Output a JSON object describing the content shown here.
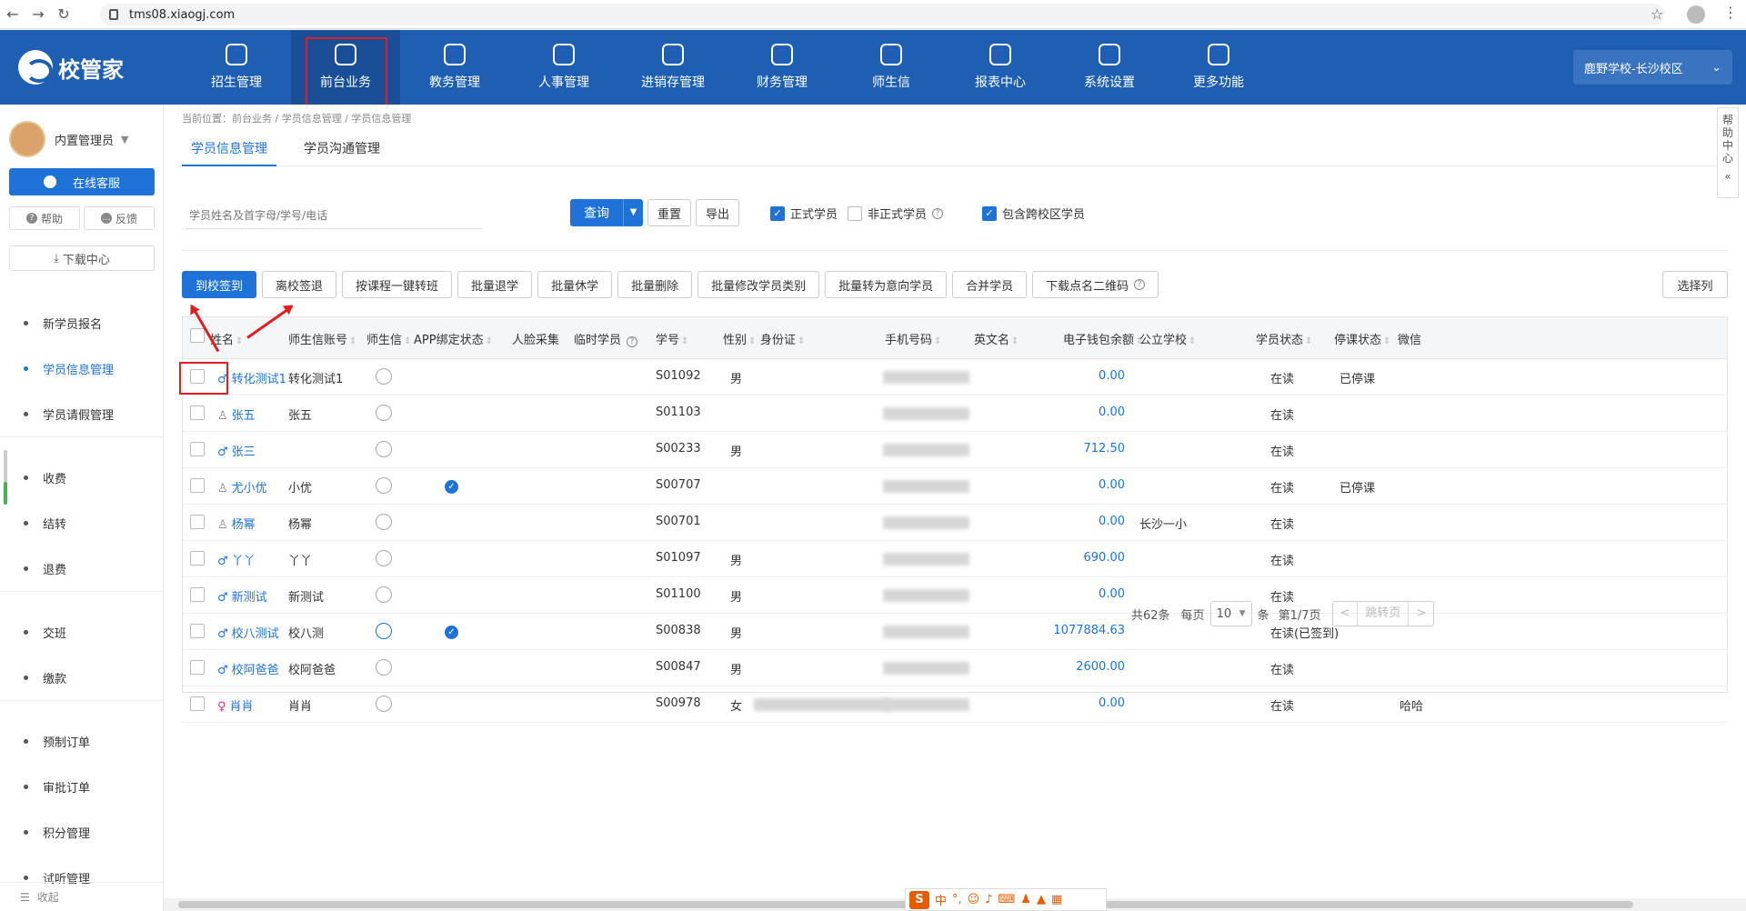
{
  "browser": {
    "url": "tms08.xiaogj.com"
  },
  "header": {
    "logo": "校管家",
    "nav": [
      {
        "label": "招生管理",
        "icon": "user-add-icon"
      },
      {
        "label": "前台业务",
        "icon": "front-desk-icon"
      },
      {
        "label": "教务管理",
        "icon": "book-icon"
      },
      {
        "label": "人事管理",
        "icon": "person-icon"
      },
      {
        "label": "进销存管理",
        "icon": "inventory-icon"
      },
      {
        "label": "财务管理",
        "icon": "finance-icon"
      },
      {
        "label": "师生信",
        "icon": "chat-icon"
      },
      {
        "label": "报表中心",
        "icon": "report-icon"
      },
      {
        "label": "系统设置",
        "icon": "settings-icon"
      },
      {
        "label": "更多功能",
        "icon": "more-icon"
      }
    ],
    "campus": "鹿野学校-长沙校区"
  },
  "sidebar": {
    "user": "内置管理员",
    "service": "在线客服",
    "help": "帮助",
    "feedback": "反馈",
    "download": "下载中心",
    "groups": [
      [
        "新学员报名",
        "学员信息管理",
        "学员请假管理"
      ],
      [
        "收费",
        "结转",
        "退费"
      ],
      [
        "交班",
        "缴款"
      ],
      [
        "预制订单",
        "审批订单",
        "积分管理",
        "试听管理"
      ]
    ],
    "collapse": "收起"
  },
  "content": {
    "breadcrumb": "当前位置：前台业务 / 学员信息管理 / 学员信息管理",
    "tabs": [
      "学员信息管理",
      "学员沟通管理"
    ],
    "search_placeholder": "学员姓名及首字母/学号/电话",
    "query": "查询",
    "reset": "重置",
    "export": "导出",
    "filters": {
      "formal": "正式学员",
      "informal": "非正式学员",
      "cross_campus": "包含跨校区学员"
    },
    "actions": [
      "到校签到",
      "离校签退",
      "按课程一键转班",
      "批量退学",
      "批量休学",
      "批量删除",
      "批量修改学员类别",
      "批量转为意向学员",
      "合并学员",
      "下载点名二维码"
    ],
    "select_columns": "选择列",
    "columns": [
      "姓名",
      "师生信账号",
      "师生信",
      "APP绑定状态",
      "人脸采集",
      "临时学员",
      "学号",
      "性别",
      "身份证",
      "手机号码",
      "英文名",
      "电子钱包余额",
      "公立学校",
      "学员状态",
      "停课状态",
      "微信"
    ],
    "rows": [
      {
        "name": "转化测试1",
        "gender_icon": "male",
        "account": "转化测试1",
        "app": false,
        "no": "S01092",
        "sex": "男",
        "balance": "0.00",
        "school": "",
        "status": "在读",
        "pause": "已停课",
        "wechat": ""
      },
      {
        "name": "张五",
        "gender_icon": "unknown",
        "account": "张五",
        "app": false,
        "no": "S01103",
        "sex": "",
        "balance": "0.00",
        "school": "",
        "status": "在读",
        "pause": "",
        "wechat": ""
      },
      {
        "name": "张三",
        "gender_icon": "male",
        "account": "",
        "app": false,
        "no": "S00233",
        "sex": "男",
        "balance": "712.50",
        "school": "",
        "status": "在读",
        "pause": "",
        "wechat": ""
      },
      {
        "name": "尤小优",
        "gender_icon": "unknown",
        "account": "小优",
        "app": true,
        "no": "S00707",
        "sex": "",
        "balance": "0.00",
        "school": "",
        "status": "在读",
        "pause": "已停课",
        "wechat": ""
      },
      {
        "name": "杨幂",
        "gender_icon": "unknown",
        "account": "杨幂",
        "app": false,
        "no": "S00701",
        "sex": "",
        "balance": "0.00",
        "school": "长沙一小",
        "status": "在读",
        "pause": "",
        "wechat": ""
      },
      {
        "name": "丫丫",
        "gender_icon": "male",
        "account": "丫丫",
        "app": false,
        "no": "S01097",
        "sex": "男",
        "balance": "690.00",
        "school": "",
        "status": "在读",
        "pause": "",
        "wechat": ""
      },
      {
        "name": "新测试",
        "gender_icon": "male",
        "account": "新测试",
        "app": false,
        "no": "S01100",
        "sex": "男",
        "balance": "0.00",
        "school": "",
        "status": "在读",
        "pause": "",
        "wechat": ""
      },
      {
        "name": "校八测试",
        "gender_icon": "male",
        "account": "校八测",
        "app": true,
        "no": "S00838",
        "sex": "男",
        "balance": "1077884.63",
        "school": "",
        "status": "在读(已签到)",
        "pause": "",
        "wechat": ""
      },
      {
        "name": "校阿爸爸",
        "gender_icon": "male",
        "account": "校阿爸爸",
        "app": false,
        "no": "S00847",
        "sex": "男",
        "balance": "2600.00",
        "school": "",
        "status": "在读",
        "pause": "",
        "wechat": ""
      },
      {
        "name": "肖肖",
        "gender_icon": "female",
        "account": "肖肖",
        "app": false,
        "no": "S00978",
        "sex": "女",
        "balance": "0.00",
        "school": "",
        "status": "在读",
        "pause": "",
        "wechat": "哈哈"
      }
    ],
    "pager": {
      "total": "共62条",
      "per_page_label": "每页",
      "per_page": "10",
      "unit": "条",
      "page": "第1/7页",
      "jump": "跳转页"
    }
  },
  "help_tab": "帮助中心",
  "ime": "中"
}
